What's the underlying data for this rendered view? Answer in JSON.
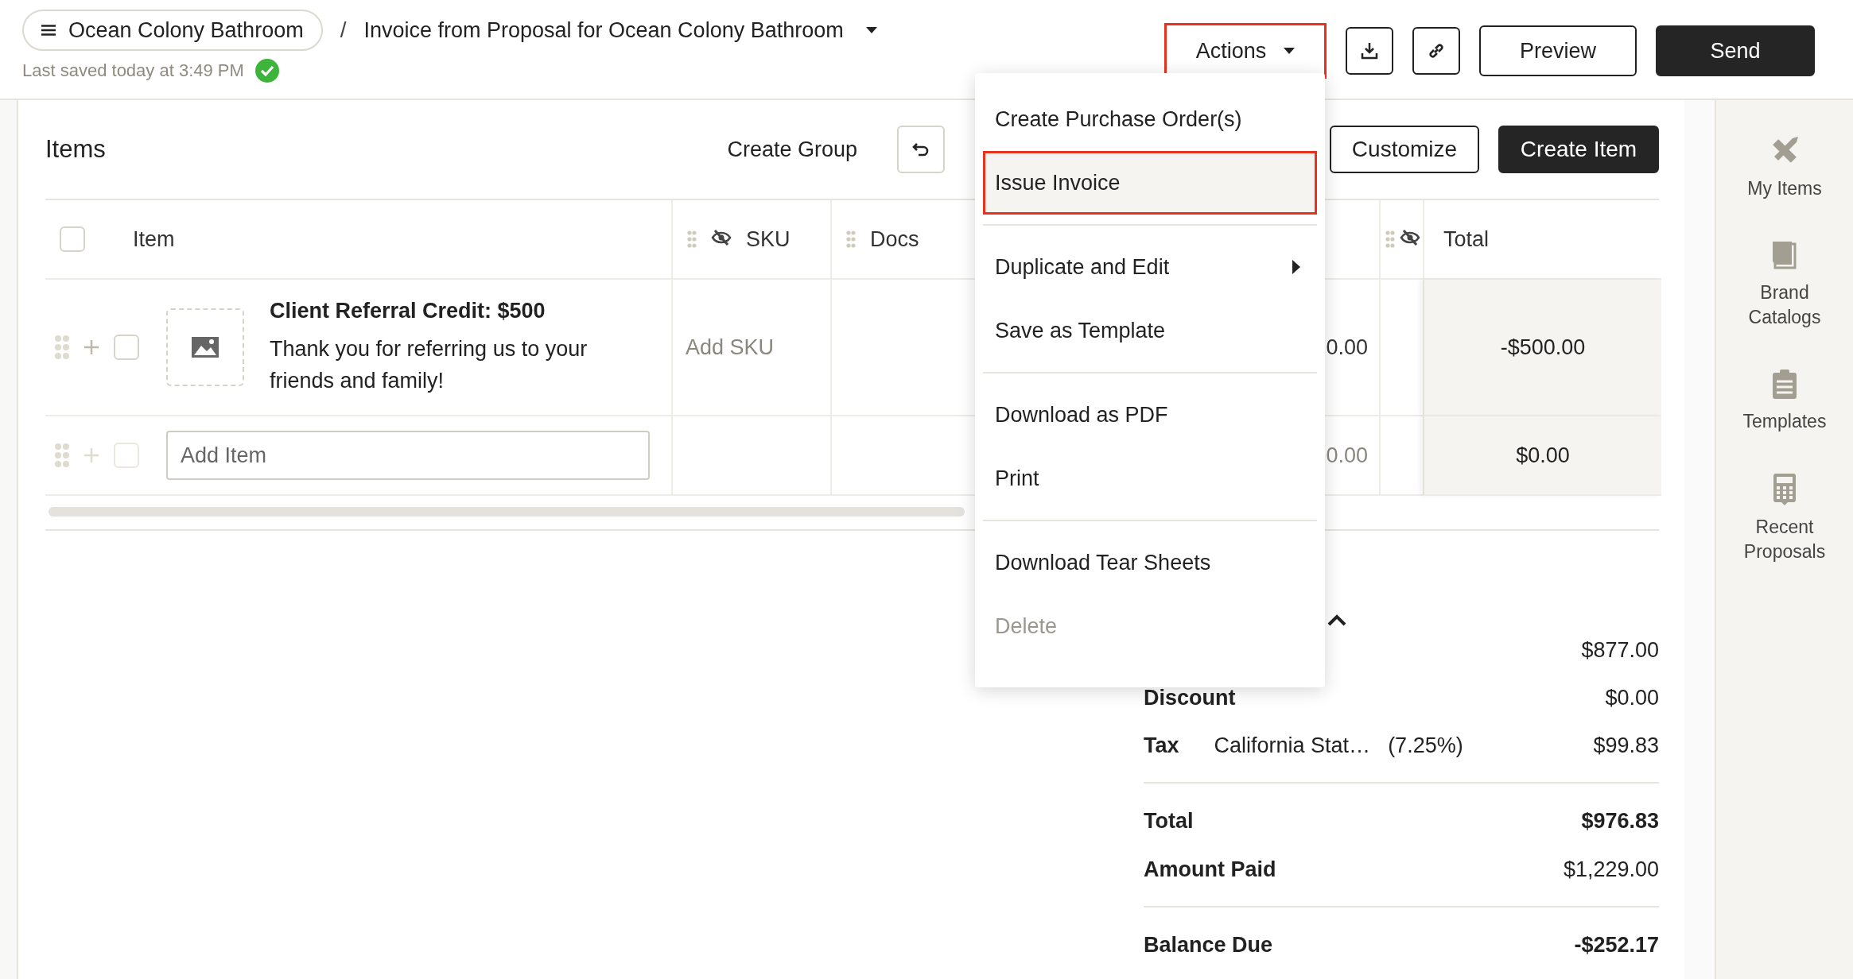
{
  "breadcrumb": {
    "project": "Ocean Colony Bathroom",
    "separator": "/",
    "document": "Invoice from Proposal for Ocean Colony Bathroom"
  },
  "save_status": {
    "text": "Last saved today at 3:49 PM",
    "saved": true
  },
  "toolbar": {
    "actions": {
      "label": "Actions",
      "highlighted": true
    },
    "preview": "Preview",
    "send": "Send"
  },
  "items_panel": {
    "title": "Items",
    "create_group": "Create Group",
    "customize": "Customize",
    "create_item": "Create Item"
  },
  "table": {
    "select_all_checked": false,
    "columns": [
      {
        "label": "Item",
        "hidden": false
      },
      {
        "label": "SKU",
        "hidden": true
      },
      {
        "label": "Docs",
        "hidden": false
      },
      {
        "label": "Total",
        "hidden": true
      }
    ],
    "rows": [
      {
        "kind": "item",
        "checked": false,
        "title": "Client Referral Credit: $500",
        "description": "Thank you for referring us to your friends and family!",
        "sku_placeholder": "Add SKU",
        "column_4": "0.00",
        "total": "-$500.00"
      },
      {
        "kind": "new",
        "checked": false,
        "placeholder": "Add Item",
        "column_4": "0.00",
        "total": "$0.00"
      }
    ]
  },
  "summary": {
    "expanded": true,
    "rows": [
      {
        "kind": "value_only",
        "value": "$877.00",
        "bold": false,
        "divider_before": false
      },
      {
        "kind": "line",
        "label": "Discount",
        "value": "$0.00",
        "bold": false,
        "divider_before": false
      },
      {
        "kind": "tax",
        "label": "Tax",
        "detail": "California Stat…",
        "rate": "(7.25%)",
        "value": "$99.83",
        "bold": false,
        "divider_before": false
      },
      {
        "kind": "line",
        "label": "Total",
        "value": "$976.83",
        "bold": true,
        "divider_before": true
      },
      {
        "kind": "line",
        "label": "Amount Paid",
        "value": "$1,229.00",
        "bold": false,
        "divider_before": false
      },
      {
        "kind": "line",
        "label": "Balance Due",
        "value": "-$252.17",
        "bold": true,
        "divider_before": true
      }
    ]
  },
  "actions_menu": {
    "groups": [
      [
        {
          "label": "Create Purchase Order(s)",
          "selected": false,
          "highlighted": false,
          "disabled": false,
          "submenu": false
        },
        {
          "label": "Issue Invoice",
          "selected": true,
          "highlighted": true,
          "disabled": false,
          "submenu": false
        }
      ],
      [
        {
          "label": "Duplicate and Edit",
          "selected": false,
          "highlighted": false,
          "disabled": false,
          "submenu": true
        },
        {
          "label": "Save as Template",
          "selected": false,
          "highlighted": false,
          "disabled": false,
          "submenu": false
        }
      ],
      [
        {
          "label": "Download as PDF",
          "selected": false,
          "highlighted": false,
          "disabled": false,
          "submenu": false
        },
        {
          "label": "Print",
          "selected": false,
          "highlighted": false,
          "disabled": false,
          "submenu": false
        }
      ],
      [
        {
          "label": "Download Tear Sheets",
          "selected": false,
          "highlighted": false,
          "disabled": false,
          "submenu": false
        },
        {
          "label": "Delete",
          "selected": false,
          "highlighted": false,
          "disabled": true,
          "submenu": false
        }
      ]
    ]
  },
  "sidebar": {
    "items": [
      {
        "label": "My Items"
      },
      {
        "label": "Brand Catalogs"
      },
      {
        "label": "Templates"
      },
      {
        "label": "Recent Proposals"
      }
    ]
  }
}
